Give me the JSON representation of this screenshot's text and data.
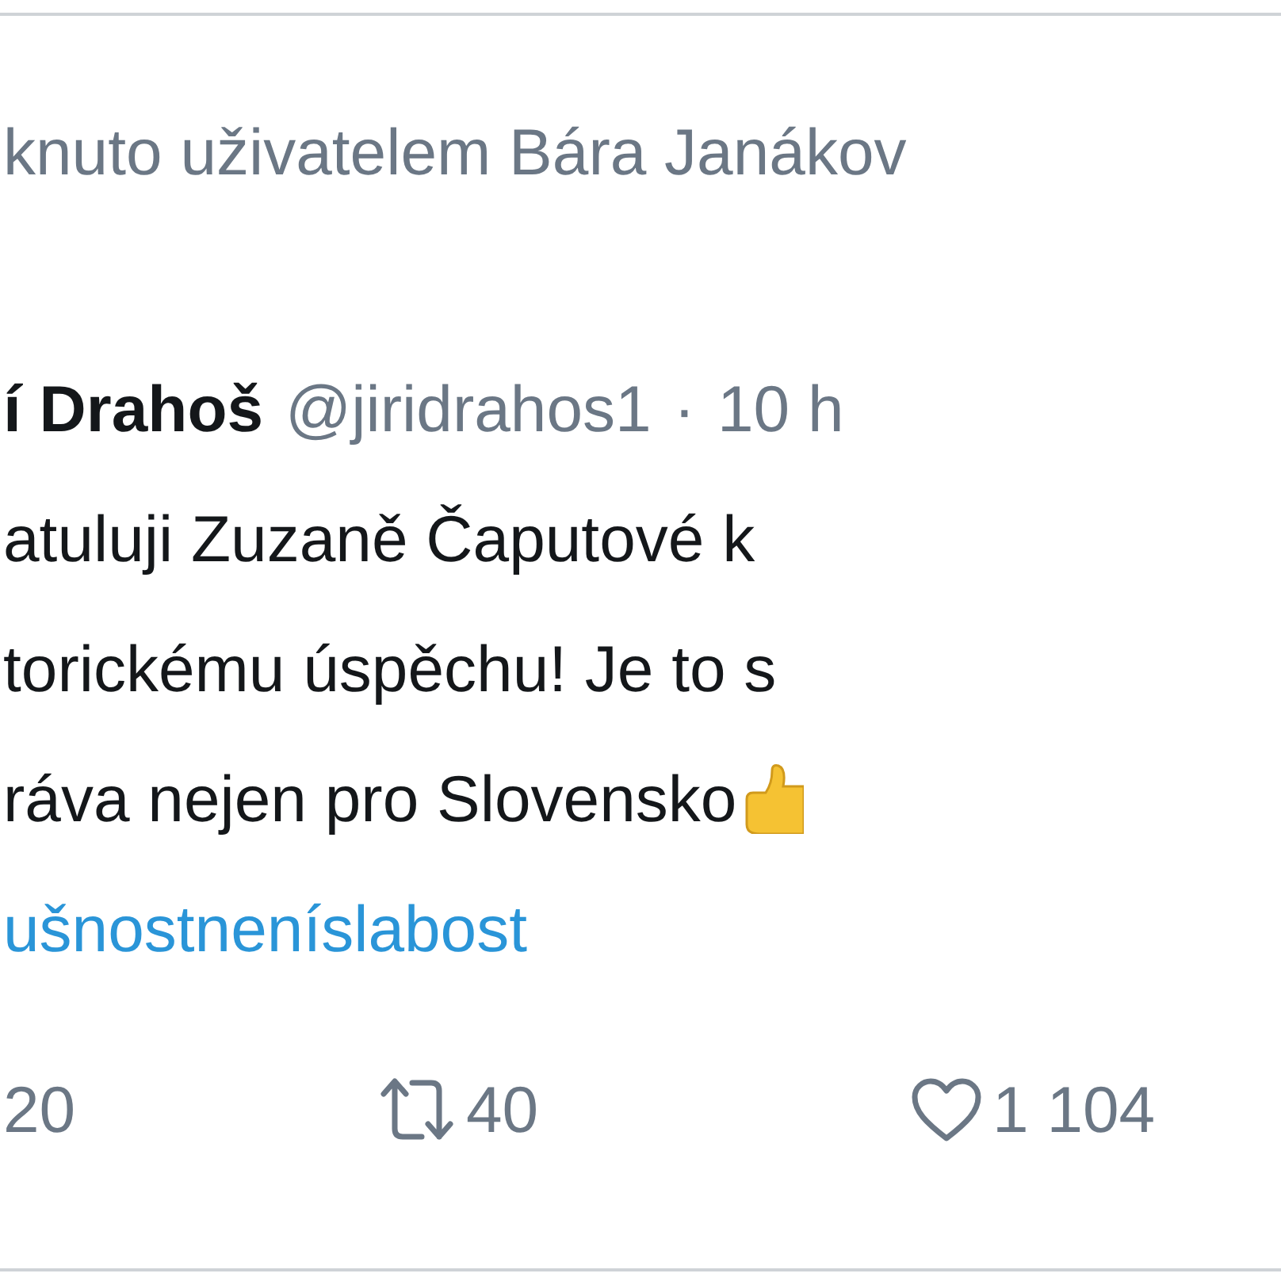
{
  "retweet_header": {
    "text": "knuto uživatelem Bára Janákov"
  },
  "tweet": {
    "author_name": "í Drahoš",
    "handle": "@jiridrahos1",
    "separator": "·",
    "time": "10 h",
    "lines": [
      "atuluji Zuzaně Čaputové k",
      "torickému úspěchu! Je to s",
      "ráva nejen pro Slovensko"
    ],
    "hashtag": "ušnostneníslabost",
    "actions": [
      {
        "kind": "reply",
        "count": "20"
      },
      {
        "kind": "retweet",
        "count": "40"
      },
      {
        "kind": "like",
        "count": "1 104",
        "liked": false
      }
    ]
  }
}
